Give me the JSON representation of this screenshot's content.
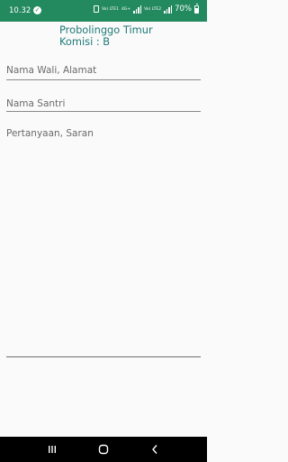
{
  "status_bar": {
    "time": "10.32",
    "battery": "70%",
    "battery_level": 0.7,
    "icons": [
      "check-circle-icon",
      "lock-icon",
      "volte-icon",
      "4g-icon",
      "signal-icon",
      "signal-icon",
      "battery-icon"
    ],
    "network_labels": [
      "Vo) LTE1",
      "4G+",
      "Vo) LTE2"
    ]
  },
  "header": {
    "line1": "Probolinggo Timur",
    "line2": "Komisi : B"
  },
  "form": {
    "wali_placeholder": "Nama Wali, Alamat",
    "santri_placeholder": "Nama Santri",
    "question_placeholder": "Pertanyaan, Saran"
  },
  "nav_bar": {
    "icons": [
      "recent-apps-icon",
      "home-icon",
      "back-icon"
    ]
  },
  "colors": {
    "status_bar": "#23895f",
    "title": "#1f7a78",
    "background": "#fafafa",
    "nav_bar": "#000000"
  }
}
